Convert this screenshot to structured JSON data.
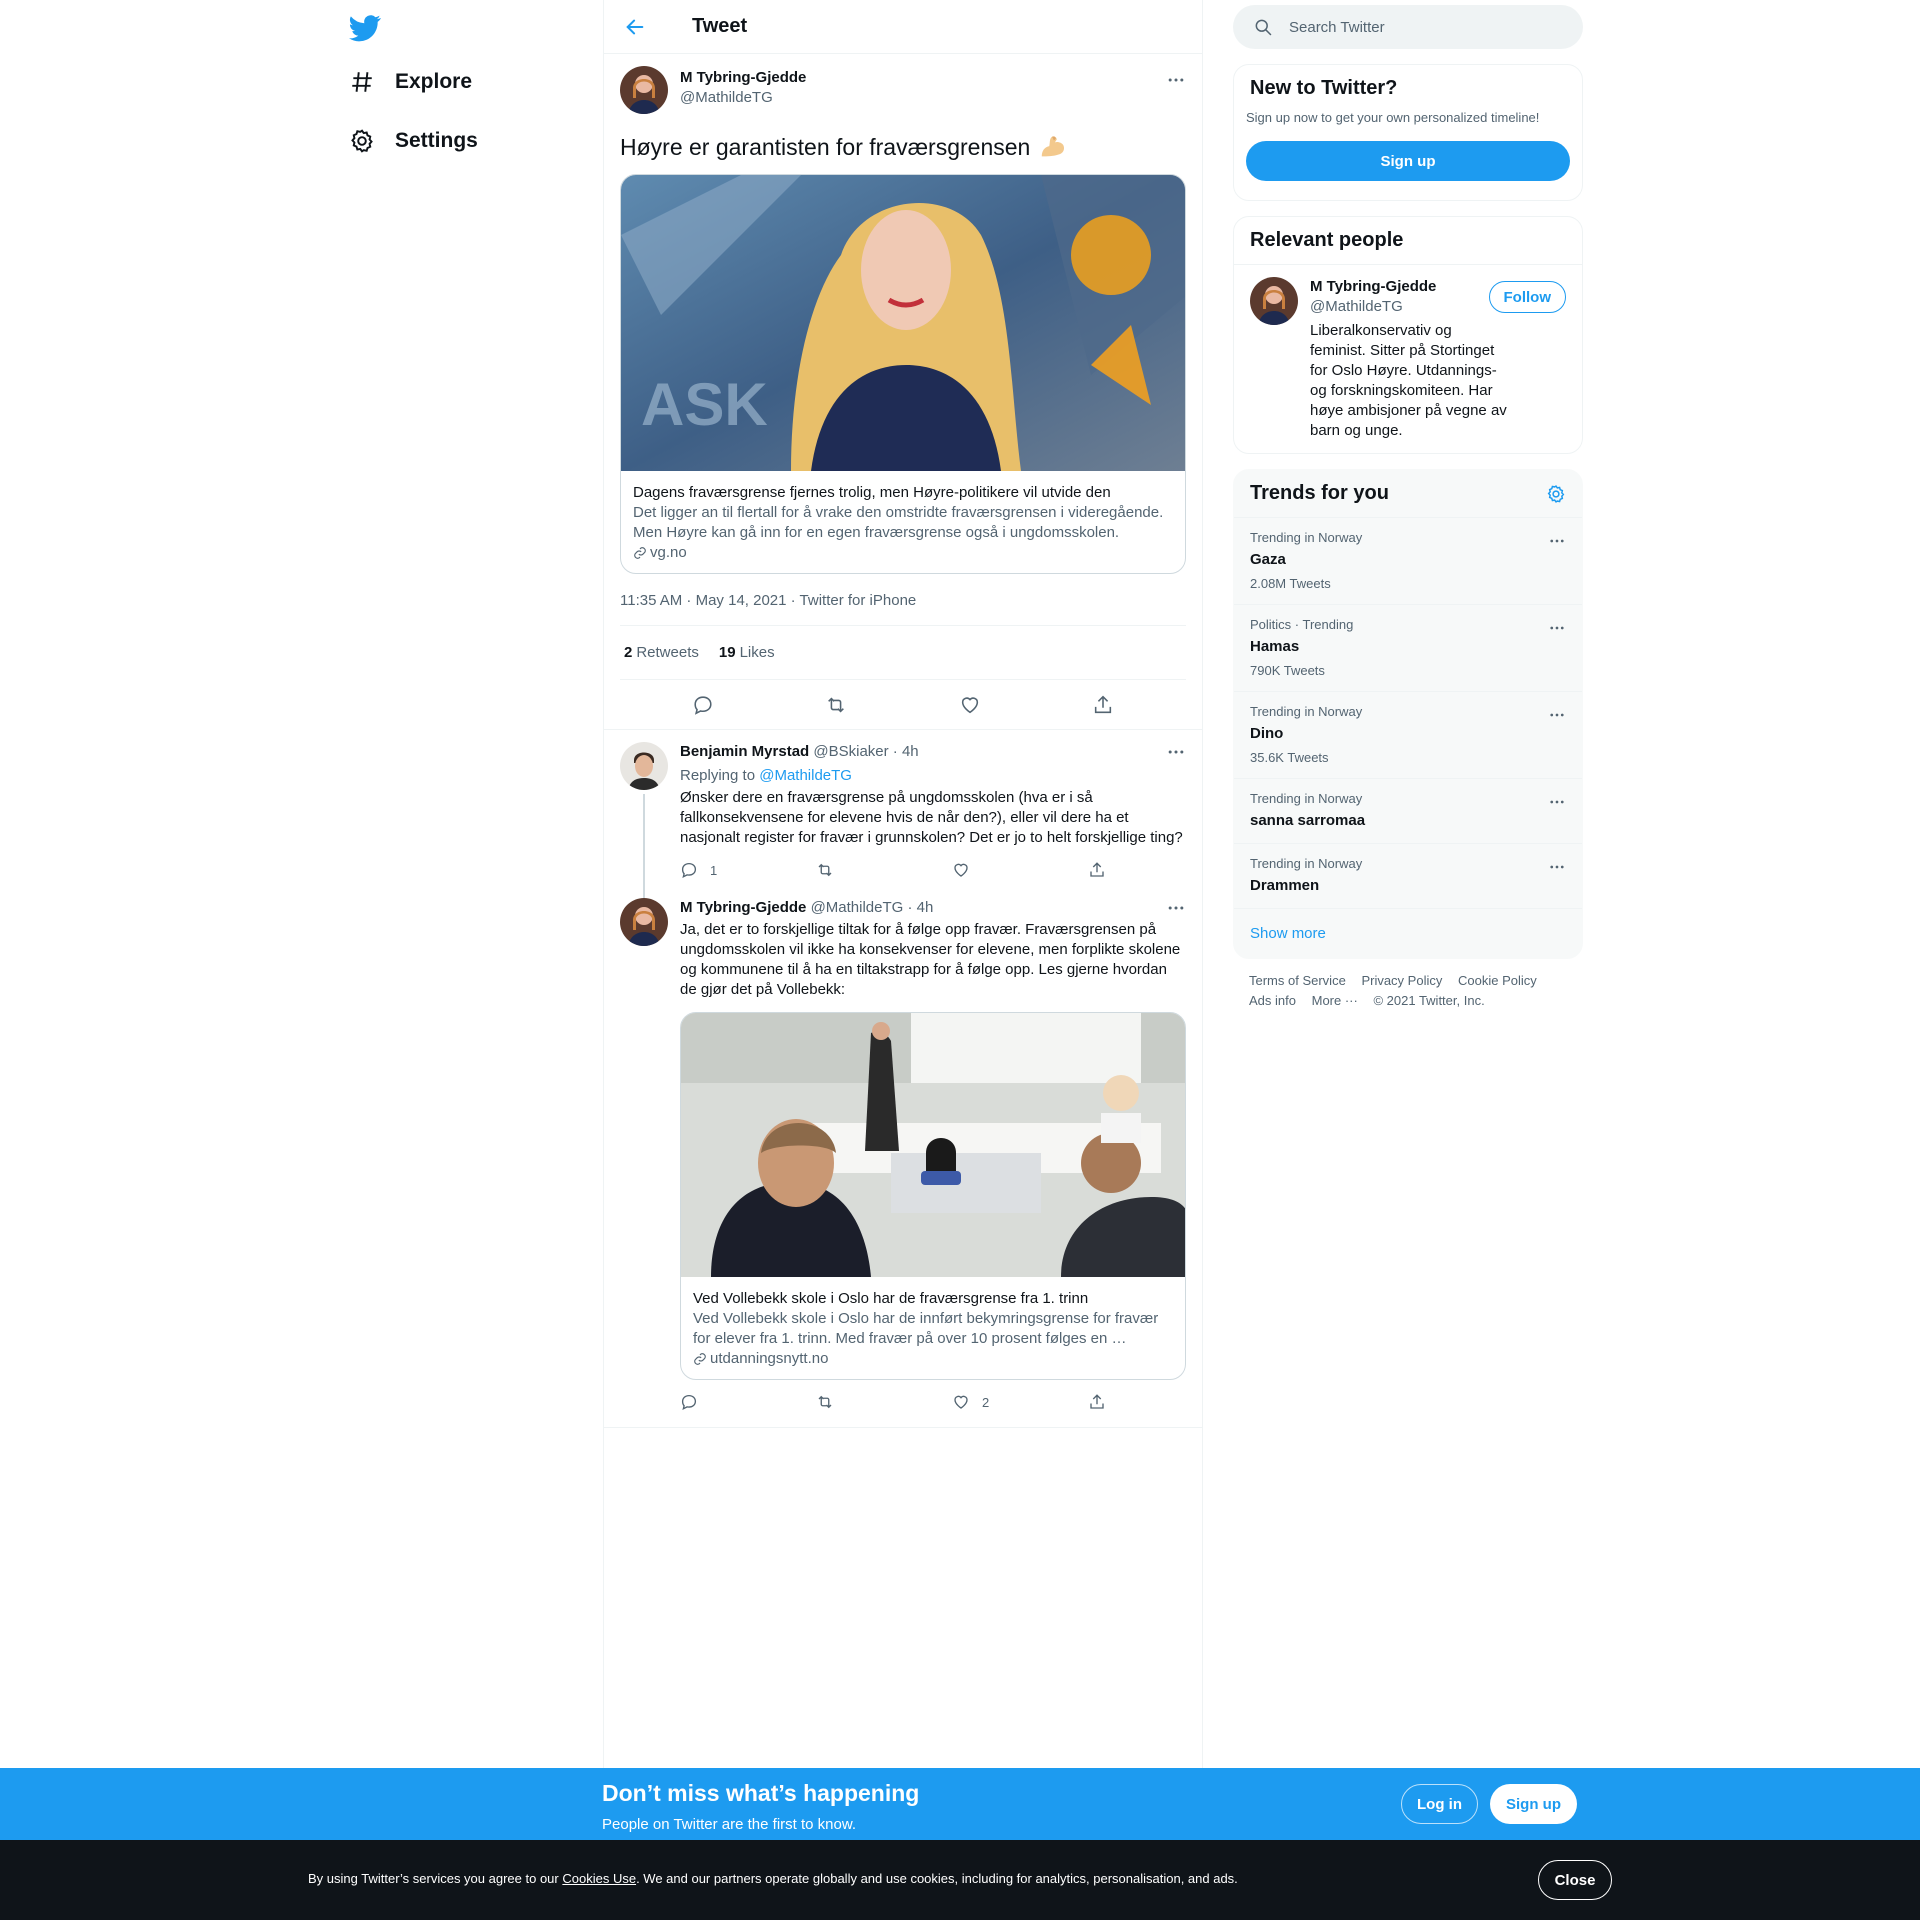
{
  "nav": {
    "logo_icon": "twitter-bird-icon",
    "explore_label": "Explore",
    "settings_label": "Settings"
  },
  "header": {
    "title": "Tweet"
  },
  "main_tweet": {
    "name": "M Tybring-Gjedde",
    "handle": "@MathildeTG",
    "text": "Høyre er garantisten for fraværsgrensen",
    "emoji": "flexed-biceps",
    "card": {
      "title": "Dagens fraværsgrense fjernes trolig, men Høyre-politikere vil utvide den",
      "description": "Det ligger an til flertall for å vrake den omstridte fraværsgrensen i videregående. Men Høyre kan gå inn for en egen fraværsgrense også i ungdomsskolen.",
      "domain": "vg.no"
    },
    "meta": "11:35 AM · May 14, 2021 · Twitter for iPhone",
    "retweets_count": "2",
    "retweets_label": "Retweets",
    "likes_count": "19",
    "likes_label": "Likes"
  },
  "replies": [
    {
      "name": "Benjamin Myrstad",
      "handle_time": "@BSkiaker · 4h",
      "replying_prefix": "Replying to ",
      "replying_handle": "@MathildeTG",
      "text": "Ønsker dere en fraværsgrense på ungdomsskolen (hva er i så fallkonsekvensene for elevene hvis de når den?), eller vil dere ha et nasjonalt register for fravær i grunnskolen? Det er jo to helt forskjellige ting?",
      "reply_count": "1",
      "retweet_count": "",
      "like_count": ""
    },
    {
      "name": "M Tybring-Gjedde",
      "handle_time": "@MathildeTG · 4h",
      "text": "Ja, det er to forskjellige tiltak for å følge opp fravær. Fraværsgrensen på ungdomsskolen vil ikke ha konsekvenser for elevene, men forplikte skolene og kommunene til å ha en tiltakstrapp for å følge opp. Les gjerne hvordan de gjør det på Vollebekk:",
      "card": {
        "title": "Ved Vollebekk skole i Oslo har de fraværsgrense fra 1. trinn",
        "description": "Ved Vollebekk skole i Oslo har de innført bekymringsgrense for fravær for elever fra 1. trinn. Med fravær på over 10 prosent følges en …",
        "domain": "utdanningsnytt.no"
      },
      "reply_count": "",
      "retweet_count": "",
      "like_count": "2"
    }
  ],
  "search": {
    "placeholder": "Search Twitter"
  },
  "new_to_twitter": {
    "title": "New to Twitter?",
    "subtitle": "Sign up now to get your own personalized timeline!",
    "button": "Sign up"
  },
  "relevant_people": {
    "title": "Relevant people",
    "name": "M Tybring-Gjedde",
    "handle": "@MathildeTG",
    "follow": "Follow",
    "bio": "Liberalkonservativ og feminist. Sitter på Stortinget for Oslo Høyre. Utdannings- og forskningskomiteen. Har høye ambisjoner på vegne av barn og unge."
  },
  "trends": {
    "title": "Trends for you",
    "items": [
      {
        "meta": "Trending in Norway",
        "name": "Gaza",
        "count": "2.08M Tweets"
      },
      {
        "meta": "Politics · Trending",
        "name": "Hamas",
        "count": "790K Tweets"
      },
      {
        "meta": "Trending in Norway",
        "name": "Dino",
        "count": "35.6K Tweets"
      },
      {
        "meta": "Trending in Norway",
        "name": "sanna sarromaa",
        "count": ""
      },
      {
        "meta": "Trending in Norway",
        "name": "Drammen",
        "count": ""
      }
    ],
    "show_more": "Show more"
  },
  "footer": {
    "terms": "Terms of Service",
    "privacy": "Privacy Policy",
    "cookie": "Cookie Policy",
    "ads": "Ads info",
    "more": "More ···",
    "copyright": "© 2021 Twitter, Inc."
  },
  "banner": {
    "title": "Don’t miss what’s happening",
    "subtitle": "People on Twitter are the first to know.",
    "login": "Log in",
    "signup": "Sign up"
  },
  "cookie_bar": {
    "text_before": "By using Twitter’s services you agree to our ",
    "link": "Cookies Use",
    "text_after": ". We and our partners operate globally and use cookies, including for analytics, personalisation, and ads.",
    "close": "Close"
  },
  "colors": {
    "accent": "#1d9bf0",
    "text_primary": "#0f1419",
    "text_secondary": "#536471",
    "border": "#eff3f4",
    "cookie_bg": "#0f1419"
  }
}
